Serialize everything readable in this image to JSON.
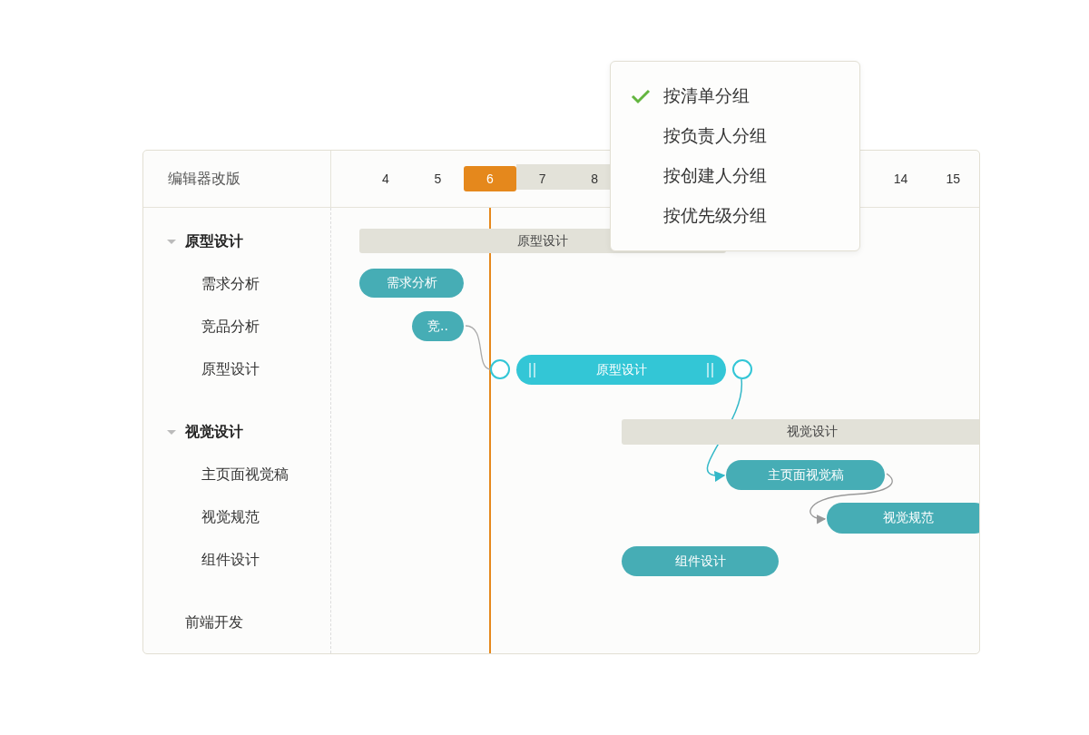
{
  "project": {
    "title": "编辑器改版"
  },
  "timeline": {
    "days_left": [
      {
        "label": "4",
        "today": false
      },
      {
        "label": "5",
        "today": false
      },
      {
        "label": "6",
        "today": true
      },
      {
        "label": "7",
        "today": false
      },
      {
        "label": "8",
        "today": false
      }
    ],
    "days_right": [
      {
        "label": "14",
        "today": false
      },
      {
        "label": "15",
        "today": false
      }
    ]
  },
  "tree": [
    {
      "label": "原型设计",
      "expanded": true,
      "bar": {
        "label": "原型设计",
        "selected": false
      },
      "children": [
        {
          "label": "需求分析",
          "bar": {
            "label": "需求分析",
            "selected": false
          }
        },
        {
          "label": "竞品分析",
          "bar": {
            "label": "竞..",
            "selected": false
          }
        },
        {
          "label": "原型设计",
          "bar": {
            "label": "原型设计",
            "selected": true
          }
        }
      ]
    },
    {
      "label": "视觉设计",
      "expanded": true,
      "bar": {
        "label": "视觉设计",
        "selected": false
      },
      "children": [
        {
          "label": "主页面视觉稿",
          "bar": {
            "label": "主页面视觉稿",
            "selected": false
          }
        },
        {
          "label": "视觉规范",
          "bar": {
            "label": "视觉规范",
            "selected": false
          }
        },
        {
          "label": "组件设计",
          "bar": {
            "label": "组件设计",
            "selected": false
          }
        }
      ]
    },
    {
      "label": "前端开发"
    }
  ],
  "menu": {
    "items": [
      {
        "label": "按清单分组",
        "checked": true
      },
      {
        "label": "按负责人分组",
        "checked": false
      },
      {
        "label": "按创建人分组",
        "checked": false
      },
      {
        "label": "按优先级分组",
        "checked": false
      }
    ]
  }
}
